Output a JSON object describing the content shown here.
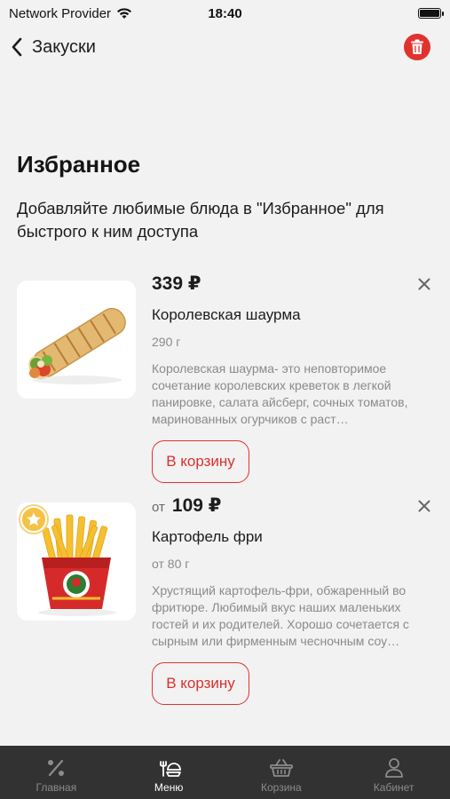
{
  "status_bar": {
    "carrier": "Network Provider",
    "time": "18:40"
  },
  "nav": {
    "back_label": "Закуски"
  },
  "favorites": {
    "title": "Избранное",
    "subtitle": "Добавляйте любимые блюда в \"Избранное\" для быстрого к ним доступа"
  },
  "items": [
    {
      "price_prefix": "",
      "price": "339 ₽",
      "name": "Королевская шаурма",
      "weight": "290 г",
      "description": "Королевская шаурма- это неповторимое сочетание королевских креветок в легкой панировке, салата айсберг, сочных томатов, маринованных огурчиков с раст…",
      "cart_label": "В корзину"
    },
    {
      "price_prefix": "от",
      "price": "109 ₽",
      "name": "Картофель фри",
      "weight": "от 80 г",
      "description": "Хрустящий картофель-фри, обжаренный во фритюре. Любимый вкус наших маленьких гостей и их родителей. Хорошо сочетается с сырным или фирменным чесночным соу…",
      "cart_label": "В корзину"
    }
  ],
  "tabs": [
    {
      "label": "Главная",
      "icon": "percent-icon"
    },
    {
      "label": "Меню",
      "icon": "menu-icon"
    },
    {
      "label": "Корзина",
      "icon": "basket-icon"
    },
    {
      "label": "Кабинет",
      "icon": "profile-icon"
    }
  ],
  "colors": {
    "accent": "#e0332f",
    "background": "#f2f2f2",
    "tab_bar": "#333232"
  }
}
